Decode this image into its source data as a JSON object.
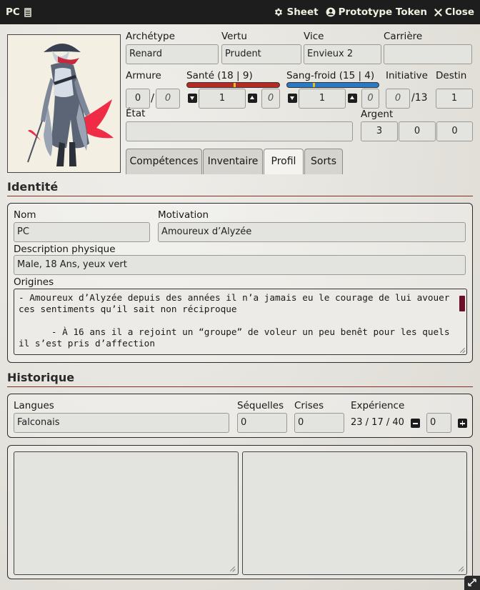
{
  "window": {
    "title": "PC",
    "controls": [
      {
        "icon": "gear-icon",
        "label": "Sheet"
      },
      {
        "icon": "user-circle-icon",
        "label": "Prototype Token"
      },
      {
        "icon": "close-icon",
        "label": "Close"
      }
    ]
  },
  "header": {
    "archetype": {
      "label": "Archétype",
      "value": "Renard"
    },
    "vertu": {
      "label": "Vertu",
      "value": "Prudent"
    },
    "vice": {
      "label": "Vice",
      "value": "Envieux 2"
    },
    "carriere": {
      "label": "Carrière",
      "value": ""
    },
    "armure": {
      "label": "Armure",
      "value1": "0",
      "value2": "0"
    },
    "sante": {
      "label": "Santé (18 | 9)",
      "value": "1",
      "extra": "0",
      "bar_color": "#b52a23",
      "marker_fraction": 0.5
    },
    "sangfroid": {
      "label": "Sang-froid (15 | 4)",
      "value": "1",
      "extra": "0",
      "bar_color": "#2a79c4",
      "marker_fraction": 0.28
    },
    "initiative": {
      "label": "Initiative",
      "value": "0",
      "max": "/13"
    },
    "destin": {
      "label": "Destin",
      "value": "1"
    },
    "etat": {
      "label": "État",
      "value": ""
    },
    "argent": {
      "label": "Argent",
      "values": [
        "3",
        "0",
        "0"
      ]
    }
  },
  "tabs": [
    {
      "label": "Compétences",
      "active": false
    },
    {
      "label": "Inventaire",
      "active": false
    },
    {
      "label": "Profil",
      "active": true
    },
    {
      "label": "Sorts",
      "active": false
    }
  ],
  "identite": {
    "title": "Identité",
    "nom": {
      "label": "Nom",
      "value": "PC"
    },
    "motivation": {
      "label": "Motivation",
      "value": "Amoureux d’Alyzée"
    },
    "description": {
      "label": "Description physique",
      "value": "Male, 18 Ans, yeux vert"
    },
    "origines": {
      "label": "Origines",
      "text": "- Amoureux d’Alyzée depuis des années il n’a jamais eu le courage de lui avouer ces sentiments qu’il sait non réciproque\n\n      - À 16 ans il a rejoint un “groupe” de voleur un peu benêt pour les quels il s’est pris d’affection\n        ..."
    }
  },
  "historique": {
    "title": "Historique",
    "langues": {
      "label": "Langues",
      "value": "Falconais"
    },
    "sequelles": {
      "label": "Séquelles",
      "value": "0"
    },
    "crises": {
      "label": "Crises",
      "value": "0"
    },
    "experience": {
      "label": "Expérience",
      "text": "23 / 17 / 40",
      "value": "0"
    }
  },
  "colors": {
    "accent": "#8a2a20",
    "scrollbar": "#6d0f26",
    "titlebar": "#1d1d1d"
  }
}
